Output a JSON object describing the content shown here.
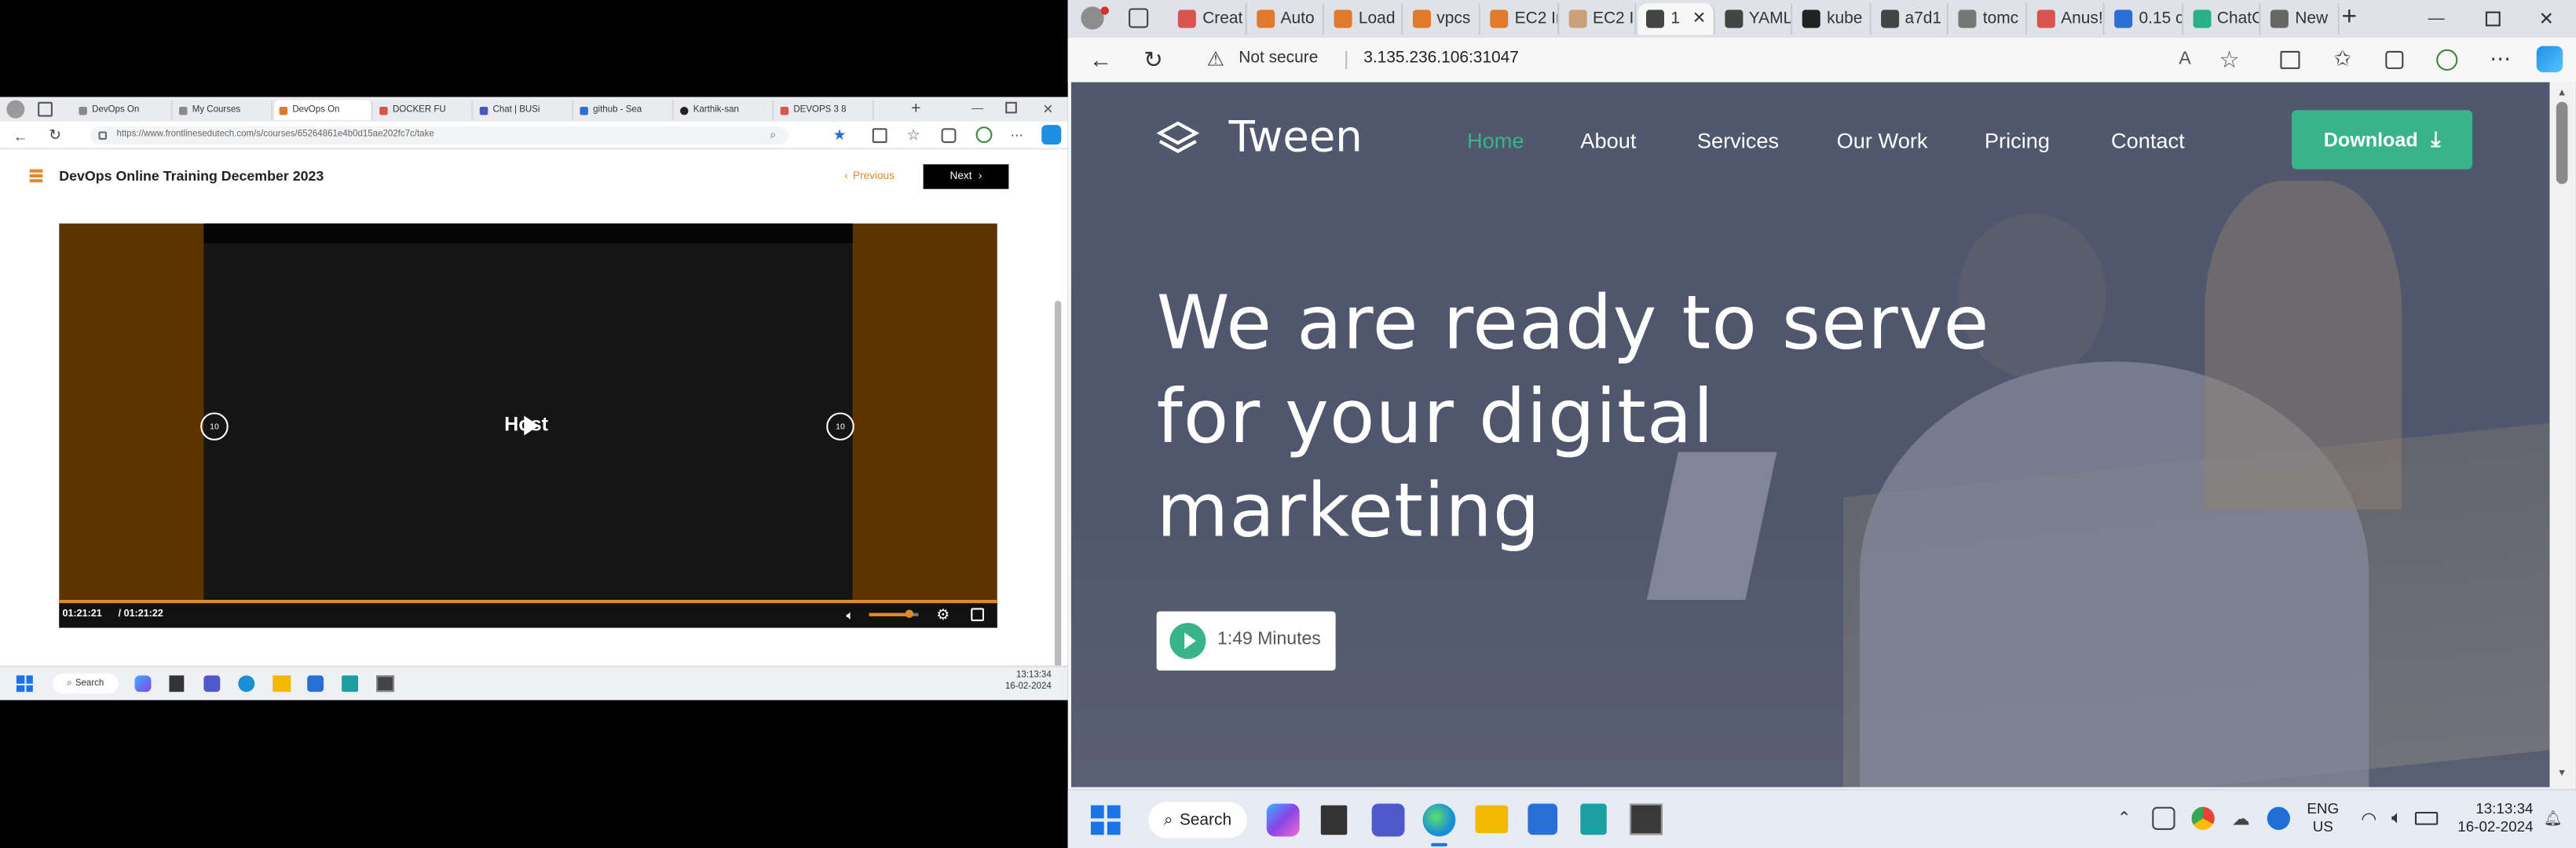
{
  "left": {
    "tabs": [
      "DevOps On",
      "My Courses",
      "DevOps On",
      "DOCKER FU",
      "Chat | BUSi",
      "github - Sea",
      "Karthik-san",
      "DEVOPS 3 8"
    ],
    "url": "https://www.frontlinesedutech.com/s/courses/65264861e4b0d15ae202fc7c/take",
    "course_title": "DevOps Online Training December 2023",
    "prev_label": "Previous",
    "next_label": "Next",
    "video_center_text": "Host",
    "current_time": "01:21:21",
    "duration": "/ 01:21:22",
    "progress": 0.9999,
    "volume": 0.8,
    "skip_seconds": "10",
    "search_label": "Search",
    "time": "13:13:34",
    "date": "16-02-2024"
  },
  "right": {
    "tabs": [
      "Creat",
      "Auto",
      "Load",
      "vpcs",
      "EC2 Ir",
      "EC2 Ir",
      "1",
      "YAML",
      "kube",
      "a7d1",
      "tomc",
      "Anus!",
      "0.15 c",
      "ChatC",
      "New"
    ],
    "security": "Not secure",
    "url": "3.135.236.106:31047",
    "site": {
      "brand": "Tween",
      "nav": [
        "Home",
        "About",
        "Services",
        "Our Work",
        "Pricing",
        "Contact"
      ],
      "download_label": "Download",
      "hero_line1": "We are ready to serve",
      "hero_line2": "for your digital",
      "hero_line3": "marketing",
      "video_label": "1:49 Minutes"
    },
    "search_label": "Search",
    "lang1": "ENG",
    "lang2": "US",
    "time": "13:13:34",
    "date": "16-02-2024"
  },
  "colors": {
    "accent_green": "#39b389",
    "video_brown": "#5d3300",
    "next_btn": "#000000",
    "prev_text": "#e08a2c"
  }
}
